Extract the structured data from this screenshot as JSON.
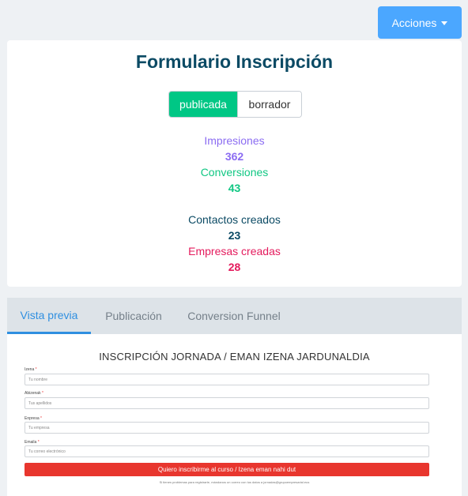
{
  "actions": {
    "label": "Acciones"
  },
  "form": {
    "title": "Formulario Inscripción",
    "status": {
      "active": "publicada",
      "inactive": "borrador"
    }
  },
  "stats": {
    "impressions": {
      "label": "Impresiones",
      "value": "362"
    },
    "conversions": {
      "label": "Conversiones",
      "value": "43"
    },
    "contacts": {
      "label": "Contactos creados",
      "value": "23"
    },
    "companies": {
      "label": "Empresas creadas",
      "value": "28"
    }
  },
  "tabs": [
    "Vista previa",
    "Publicación",
    "Conversion Funnel"
  ],
  "preview": {
    "title": "INSCRIPCIÓN JORNADA / EMAN IZENA JARDUNALDIA",
    "fields": [
      {
        "label": "Izena",
        "placeholder": "Tu nombre"
      },
      {
        "label": "Abizenak",
        "placeholder": "Tus apellidos"
      },
      {
        "label": "Enpresa",
        "placeholder": "Tu empresa"
      },
      {
        "label": "Emaila",
        "placeholder": "Tu correo electrónico"
      }
    ],
    "submit": "Quiero inscribirme al curso / Izena eman nahi dut",
    "footnote": "Si tienes problemas para registrarte, mándanos un correo con tus datos a jornadas@grupoempresarial.eus"
  }
}
